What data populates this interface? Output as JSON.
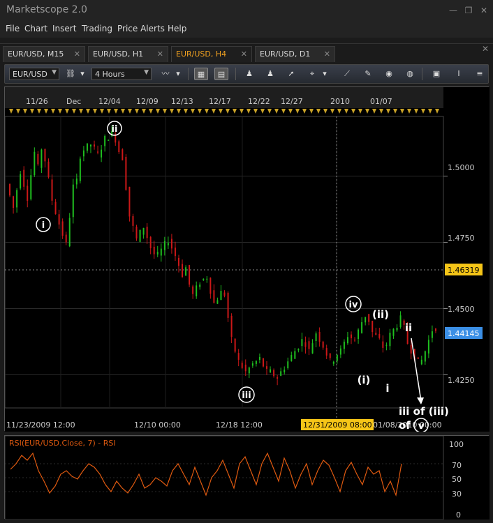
{
  "app": {
    "title": "Marketscope 2.0"
  },
  "window_controls": {
    "minimize": "—",
    "restore": "❐",
    "close": "✕"
  },
  "menu": [
    "File",
    "Chart",
    "Insert",
    "Trading",
    "Price Alerts",
    "Help"
  ],
  "tabs": [
    {
      "label": "EUR/USD, M15",
      "active": false
    },
    {
      "label": "EUR/USD, H1",
      "active": false
    },
    {
      "label": "EUR/USD, H4",
      "active": true
    },
    {
      "label": "EUR/USD, D1",
      "active": false
    }
  ],
  "tab_close": "✕",
  "toolbar": {
    "symbol": "EUR/USD",
    "timeframe": "4 Hours"
  },
  "chart": {
    "top_dates": [
      "11/26",
      "Dec",
      "12/04",
      "12/09",
      "12/13",
      "12/17",
      "12/22",
      "12/27",
      "2010",
      "01/07"
    ],
    "bottom_dates": [
      "11/23/2009 12:00",
      "12/10 00:00",
      "12/18 12:00",
      "01/08/2010 00:00"
    ],
    "cursor_date": "12/31/2009 08:00",
    "price_ticks": [
      "1.5000",
      "1.4750",
      "1.4500",
      "1.4250"
    ],
    "crosshair_price": "1.46319",
    "last_price": "1.44145",
    "accent_colors": {
      "up": "#1fbf1f",
      "down": "#cc1818",
      "crosshair_label": "#f5c518",
      "last_label": "#3b8fe6"
    }
  },
  "waves": {
    "i_circ": "i",
    "ii_circ": "ii",
    "iii_circ": "iii",
    "iv_circ": "iv",
    "paren_i": "(i)",
    "paren_ii": "(ii)",
    "small_i": "i",
    "small_ii": "ii",
    "iii_of": "iii of (iii)",
    "of": "of",
    "v_circ": "v"
  },
  "rsi": {
    "label": "RSI(EUR/USD.Close, 7) - RSI",
    "ticks": [
      "100",
      "70",
      "50",
      "30",
      "0"
    ],
    "line_color": "#e05a10"
  },
  "chart_data": {
    "type": "candlestick",
    "symbol": "EUR/USD",
    "timeframe": "4 Hours",
    "ylim": [
      1.4125,
      1.5225
    ],
    "segments": [
      [
        1.497,
        1.488,
        1.502,
        1.492,
        1.509,
        1.497
      ],
      [
        1.515,
        1.506,
        1.491,
        1.482,
        1.474,
        1.496,
        1.5
      ],
      [
        1.506,
        1.51,
        1.512,
        1.508,
        1.514,
        1.516,
        1.512
      ],
      [
        1.512,
        1.507,
        1.485,
        1.476,
        1.481,
        1.473,
        1.468
      ],
      [
        1.468,
        1.472,
        1.476,
        1.47,
        1.463,
        1.468
      ],
      [
        1.463,
        1.455,
        1.46,
        1.462,
        1.452,
        1.456,
        1.455
      ],
      [
        1.455,
        1.438,
        1.43,
        1.426,
        1.429,
        1.431,
        1.426,
        1.426
      ],
      [
        1.426,
        1.424,
        1.428,
        1.432,
        1.436,
        1.44
      ],
      [
        1.44,
        1.434,
        1.441,
        1.436,
        1.43,
        1.432
      ],
      [
        1.432,
        1.434,
        1.44,
        1.438,
        1.445,
        1.45
      ],
      [
        1.45,
        1.441,
        1.438,
        1.433
      ],
      [
        1.433,
        1.44,
        1.444,
        1.448
      ],
      [
        1.448,
        1.437,
        1.432,
        1.427
      ],
      [
        1.427,
        1.434,
        1.442,
        1.444
      ]
    ],
    "rsi_values": [
      62,
      70,
      82,
      75,
      85,
      60,
      45,
      28,
      38,
      55,
      60,
      52,
      48,
      60,
      70,
      65,
      55,
      40,
      30,
      45,
      35,
      28,
      40,
      55,
      35,
      40,
      50,
      45,
      38,
      60,
      70,
      55,
      40,
      65,
      45,
      25,
      50,
      60,
      75,
      55,
      35,
      70,
      80,
      60,
      40,
      70,
      85,
      65,
      45,
      78,
      60,
      35,
      55,
      70,
      40,
      60,
      75,
      68,
      50,
      30,
      60,
      72,
      55,
      40,
      65,
      55,
      60,
      30,
      45,
      25,
      70
    ],
    "rsi_ylim": [
      0,
      100
    ]
  }
}
